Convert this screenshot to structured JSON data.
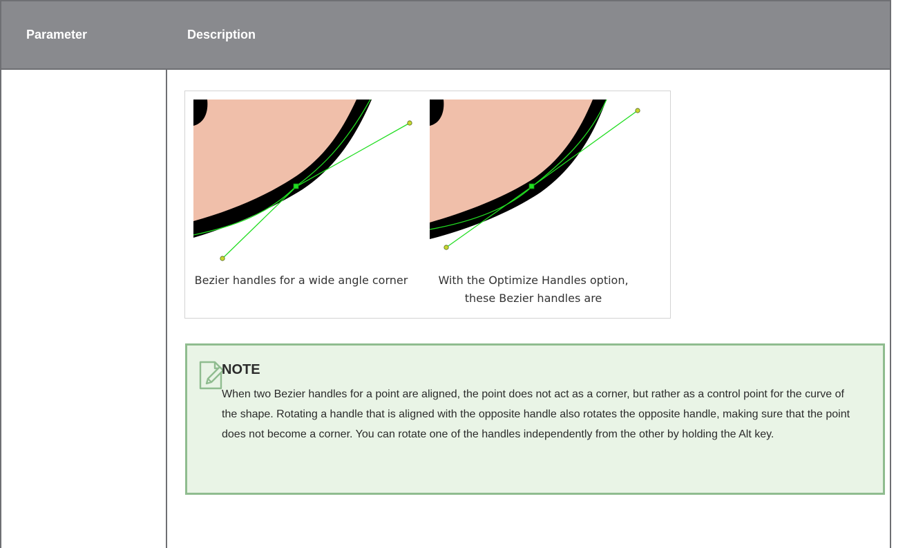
{
  "table": {
    "headers": {
      "parameter": "Parameter",
      "description": "Description"
    }
  },
  "figure": {
    "captions": [
      "Bezier handles for a wide angle corner",
      "With the Optimize Handles option, these Bezier handles are"
    ],
    "colors": {
      "skin": "#f0bfaa",
      "outline": "#000000",
      "handle": "#22dd22",
      "handle_point": "#c8d830"
    }
  },
  "note": {
    "icon": "note-pencil-icon",
    "title": "NOTE",
    "body": "When two Bezier handles for a point are aligned, the point does not act as a corner, but rather as a control point for the curve of the shape. Rotating a handle that is aligned with the opposite handle also rotates the opposite handle, making sure that the point does not become a corner. You can rotate one of the handles independently from the other by holding the Alt key."
  }
}
